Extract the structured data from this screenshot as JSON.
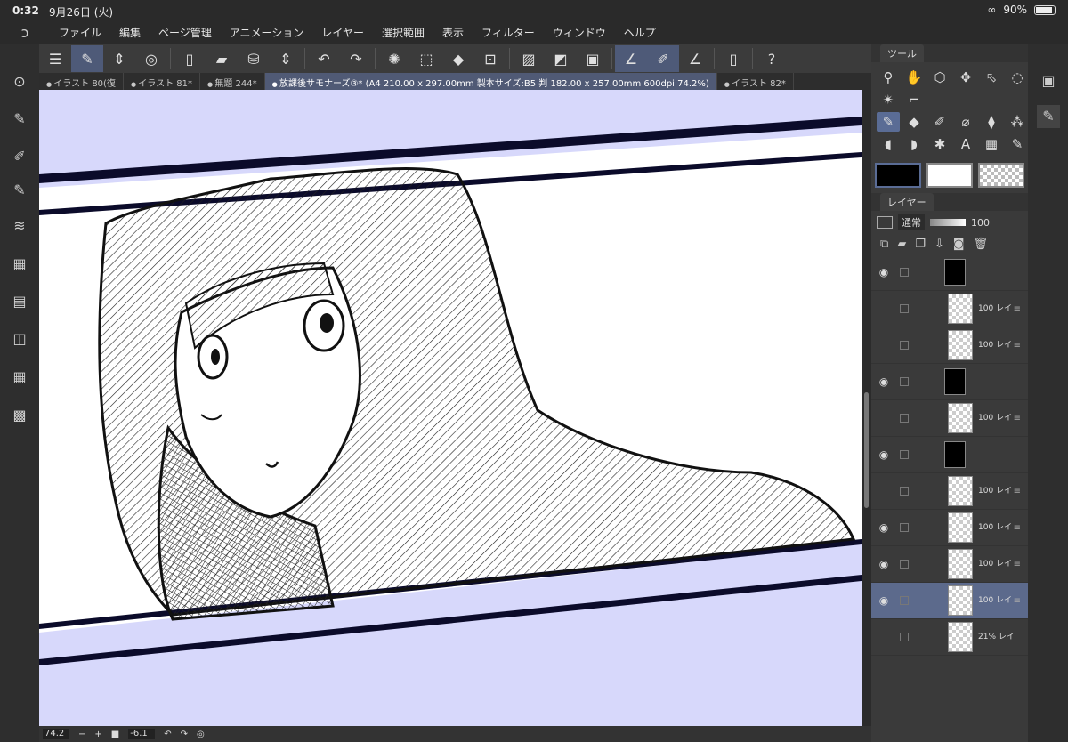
{
  "status": {
    "time": "0:32",
    "date": "9月26日 (火)",
    "battery": "90%"
  },
  "menu": [
    "ファイル",
    "編集",
    "ページ管理",
    "アニメーション",
    "レイヤー",
    "選択範囲",
    "表示",
    "フィルター",
    "ウィンドウ",
    "ヘルプ"
  ],
  "tabs": [
    {
      "label": "イラスト 80(復",
      "active": false
    },
    {
      "label": "イラスト 81*",
      "active": false
    },
    {
      "label": "無題 244*",
      "active": false
    },
    {
      "label": "放課後サモナーズ③* (A4 210.00 x 297.00mm 製本サイズ:B5 判 182.00 x 257.00mm 600dpi 74.2%)",
      "active": true
    },
    {
      "label": "イラスト 82*",
      "active": false
    }
  ],
  "bottom": {
    "zoom": "74.2",
    "angle": "-6.1"
  },
  "panels": {
    "tool_tab": "ツール",
    "layer_tab": "レイヤー",
    "blend_mode": "通常",
    "opacity": "100"
  },
  "layers": [
    {
      "label": "",
      "kind": "folder-dark"
    },
    {
      "label": "100 レイ",
      "kind": "layer"
    },
    {
      "label": "100 レイ",
      "kind": "layer"
    },
    {
      "label": "",
      "kind": "folder-bar"
    },
    {
      "label": "100 レイ",
      "kind": "layer"
    },
    {
      "label": "",
      "kind": "folder-bar"
    },
    {
      "label": "100 レイ",
      "kind": "layer"
    },
    {
      "label": "100 レイ",
      "kind": "layer"
    },
    {
      "label": "100 レイ",
      "kind": "layer"
    },
    {
      "label": "100 レイ",
      "kind": "layer-selected"
    },
    {
      "label": "21% レイ",
      "kind": "layer"
    }
  ],
  "colors": {
    "accent": "#4e5a78",
    "canvas_bg": "#d7d8fb",
    "main": "#000000",
    "sub": "#ffffff"
  }
}
